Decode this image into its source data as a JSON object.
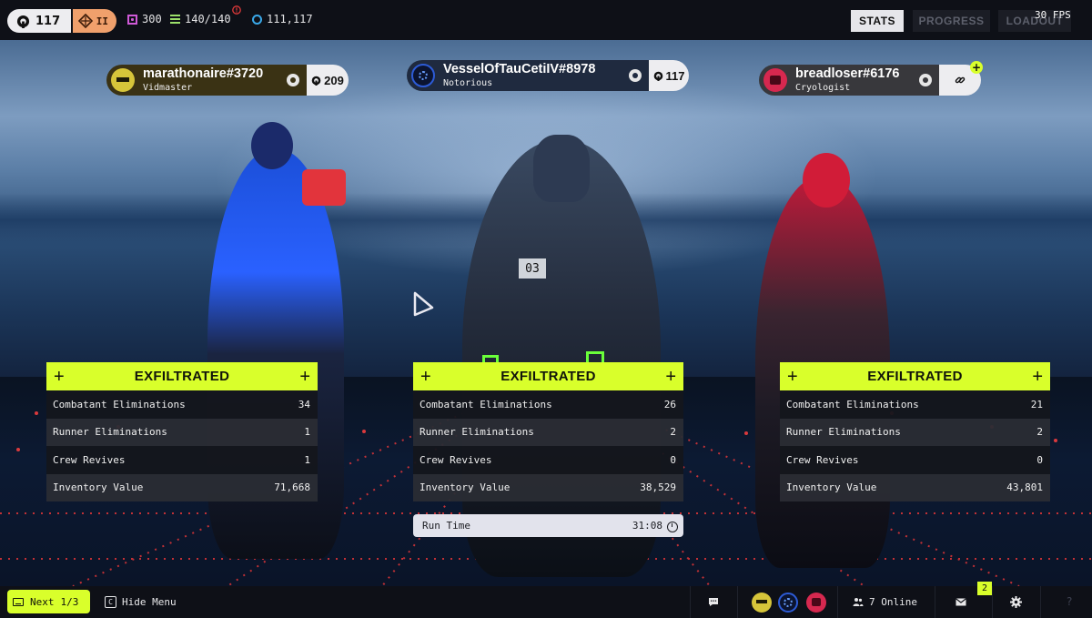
{
  "header": {
    "account_level": "117",
    "rank_numeral": "II",
    "currency": "300",
    "capacity": "140/140",
    "credits": "111,117",
    "tabs": [
      {
        "label": "STATS",
        "active": true
      },
      {
        "label": "PROGRESS",
        "active": false
      },
      {
        "label": "LOADOUT",
        "active": false
      }
    ],
    "fps": "30 FPS"
  },
  "players": [
    {
      "name": "marathonaire#3720",
      "title": "Vidmaster",
      "level": "209",
      "tag_color": "#3a3214",
      "avatar_color": "#d6c53a"
    },
    {
      "name": "VesselOfTauCetiIV#8978",
      "title": "Notorious",
      "level": "117",
      "tag_color": "#1f2a3f",
      "avatar_color": "#2d5bd6"
    },
    {
      "name": "breadloser#6176",
      "title": "Cryologist",
      "level": "",
      "tag_color": "#38383c",
      "avatar_color": "#d6284f"
    }
  ],
  "panels": [
    {
      "status": "EXFILTRATED",
      "rows": [
        {
          "label": "Combatant Eliminations",
          "value": "34"
        },
        {
          "label": "Runner Eliminations",
          "value": "1"
        },
        {
          "label": "Crew Revives",
          "value": "1"
        },
        {
          "label": "Inventory Value",
          "value": "71,668"
        }
      ]
    },
    {
      "status": "EXFILTRATED",
      "rows": [
        {
          "label": "Combatant Eliminations",
          "value": "26"
        },
        {
          "label": "Runner Eliminations",
          "value": "2"
        },
        {
          "label": "Crew Revives",
          "value": "0"
        },
        {
          "label": "Inventory Value",
          "value": "38,529"
        }
      ]
    },
    {
      "status": "EXFILTRATED",
      "rows": [
        {
          "label": "Combatant Eliminations",
          "value": "21"
        },
        {
          "label": "Runner Eliminations",
          "value": "2"
        },
        {
          "label": "Crew Revives",
          "value": "0"
        },
        {
          "label": "Inventory Value",
          "value": "43,801"
        }
      ]
    }
  ],
  "run_time": {
    "label": "Run Time",
    "value": "31:08"
  },
  "footer": {
    "next_label": "Next",
    "next_count": "1/3",
    "hide_key": "C",
    "hide_label": "Hide Menu",
    "online": "7 Online",
    "mail_count": "2",
    "help": "?"
  },
  "colors": {
    "accent": "#d9ff2b",
    "bar": "#0e1017",
    "rank": "#f0a06c"
  },
  "icons": [
    "level-icon",
    "rank-chevron-icon",
    "currency-icon",
    "capacity-icon",
    "credits-icon",
    "alert-icon",
    "steam-icon",
    "link-icon",
    "add-friend-icon",
    "clock-icon",
    "chat-icon",
    "people-icon",
    "mail-icon",
    "gear-icon",
    "help-icon",
    "cursor-icon"
  ]
}
